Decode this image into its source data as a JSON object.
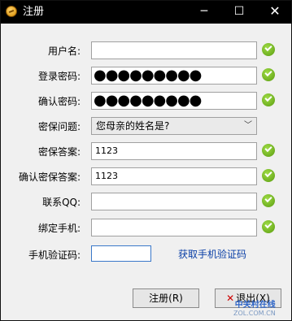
{
  "window": {
    "title": "注册",
    "minimize_glyph": "─",
    "maximize_glyph": "☐",
    "close_glyph": "✕"
  },
  "form": {
    "username": {
      "label": "用户名:",
      "value": ""
    },
    "login_password": {
      "label": "登录密码:",
      "value": "●●●●●●●●●"
    },
    "confirm_password": {
      "label": "确认密码:",
      "value": "●●●●●●●●●"
    },
    "security_question": {
      "label": "密保问题:",
      "value": "您母亲的姓名是?"
    },
    "security_answer": {
      "label": "密保答案:",
      "value": "1123"
    },
    "confirm_answer": {
      "label": "确认密保答案:",
      "value": "1123"
    },
    "qq": {
      "label": "联系QQ:",
      "value": ""
    },
    "bind_phone": {
      "label": "绑定手机:",
      "value": ""
    },
    "phone_code": {
      "label": "手机验证码:",
      "value": "",
      "get_code_link": "获取手机验证码"
    }
  },
  "buttons": {
    "register": "注册(R)",
    "exit": "退出(X)",
    "exit_icon": "✕"
  },
  "watermark": {
    "line1": "中关村在线",
    "line2": "ZOL.COM.CN"
  },
  "colors": {
    "check": "#6bb81b",
    "link": "#0a3fa6",
    "titlebar": "#000000"
  },
  "icons": [
    "app-icon",
    "check-icon",
    "chevron-down-icon",
    "close-icon"
  ]
}
